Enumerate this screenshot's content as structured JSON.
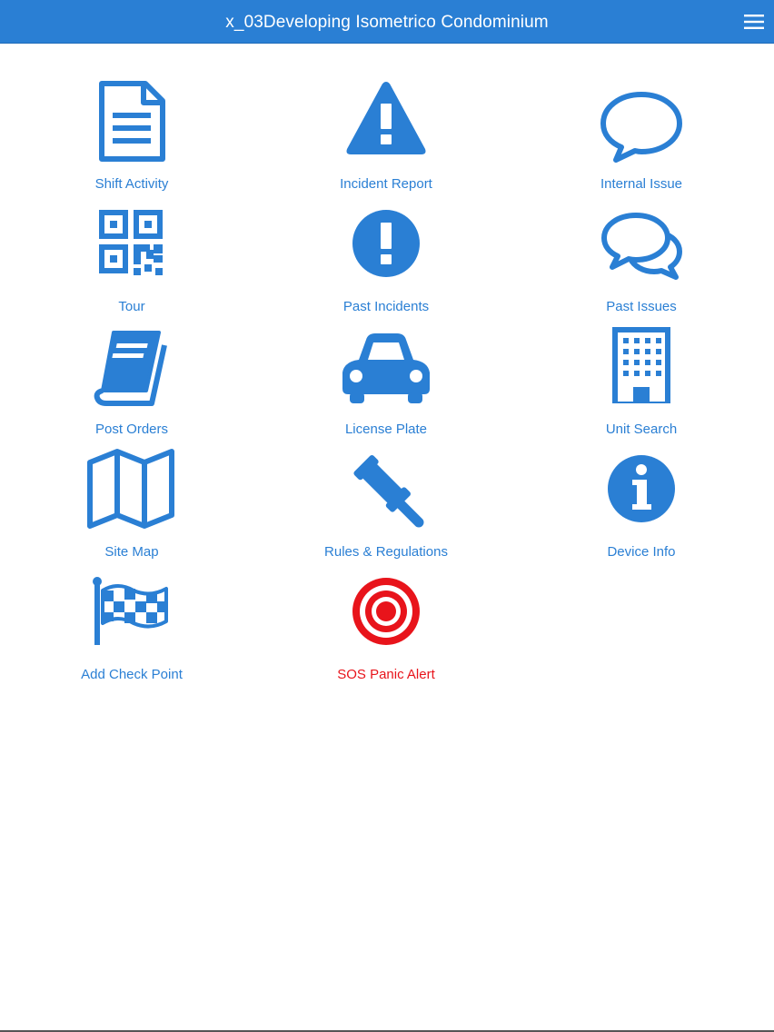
{
  "header": {
    "title": "x_03Developing Isometrico Condominium",
    "menu_icon": "hamburger-menu-icon"
  },
  "colors": {
    "brand": "#2a7fd4",
    "alert": "#e8141b"
  },
  "tiles": [
    {
      "label": "Shift Activity",
      "icon": "document-icon"
    },
    {
      "label": "Incident Report",
      "icon": "warning-triangle-icon"
    },
    {
      "label": "Internal Issue",
      "icon": "speech-bubble-icon"
    },
    {
      "label": "Tour",
      "icon": "qr-code-icon"
    },
    {
      "label": "Past Incidents",
      "icon": "exclamation-circle-icon"
    },
    {
      "label": "Past Issues",
      "icon": "speech-bubbles-icon"
    },
    {
      "label": "Post Orders",
      "icon": "book-icon"
    },
    {
      "label": "License Plate",
      "icon": "car-icon"
    },
    {
      "label": "Unit Search",
      "icon": "building-icon"
    },
    {
      "label": "Site Map",
      "icon": "map-icon"
    },
    {
      "label": "Rules & Regulations",
      "icon": "gavel-icon"
    },
    {
      "label": "Device Info",
      "icon": "info-circle-icon"
    },
    {
      "label": "Add Check Point",
      "icon": "checkered-flag-icon"
    },
    {
      "label": "SOS Panic Alert",
      "icon": "target-icon"
    }
  ]
}
